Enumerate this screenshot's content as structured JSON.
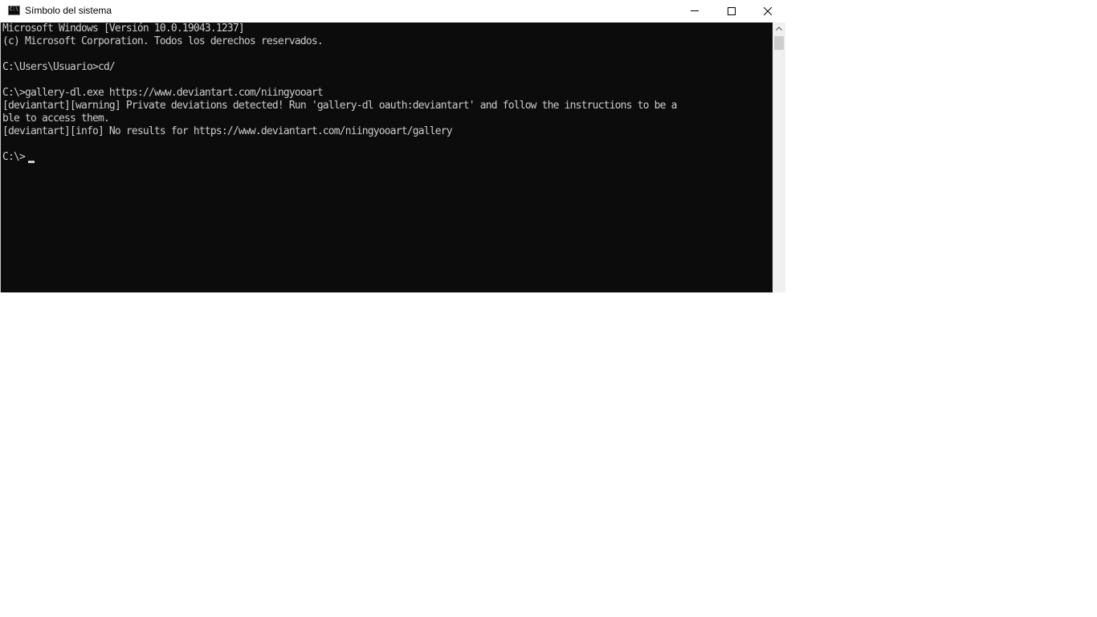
{
  "window": {
    "title": "Símbolo del sistema",
    "icon": "cmd-icon",
    "controls": {
      "minimize": "minimize-icon",
      "maximize": "maximize-icon",
      "close": "close-icon"
    }
  },
  "console": {
    "lines": [
      "Microsoft Windows [Versión 10.0.19043.1237]",
      "(c) Microsoft Corporation. Todos los derechos reservados.",
      "",
      "C:\\Users\\Usuario>cd/",
      "",
      "C:\\>gallery-dl.exe https://www.deviantart.com/niingyooart",
      "[deviantart][warning] Private deviations detected! Run 'gallery-dl oauth:deviantart' and follow the instructions to be a",
      "ble to access them.",
      "[deviantart][info] No results for https://www.deviantart.com/niingyooart/gallery",
      "",
      "C:\\>"
    ],
    "colors": {
      "background": "#0c0c0c",
      "text": "#cccccc"
    }
  }
}
